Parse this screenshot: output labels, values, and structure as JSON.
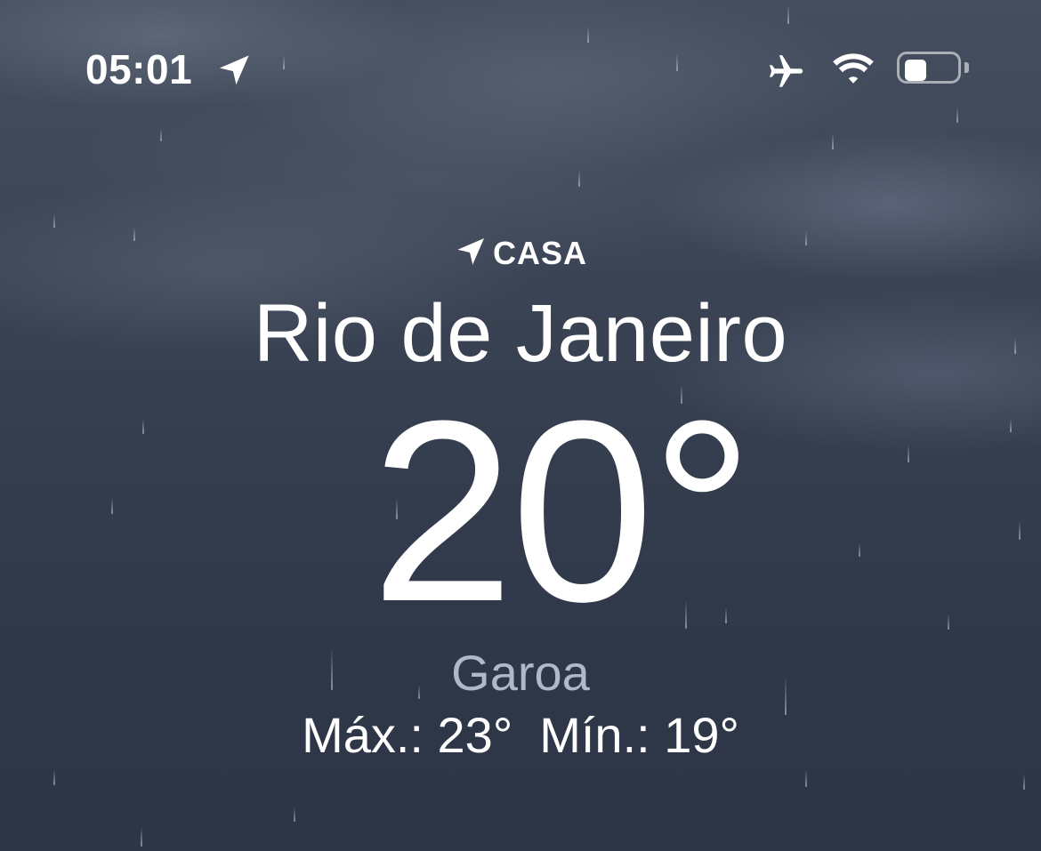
{
  "status_bar": {
    "time": "05:01",
    "location_icon": "location-arrow-icon",
    "airplane_icon": "airplane-icon",
    "wifi_icon": "wifi-icon",
    "battery_icon": "battery-icon",
    "battery_level": 0.45
  },
  "weather": {
    "home_label": "CASA",
    "home_icon": "navigation-arrow-icon",
    "city": "Rio de Janeiro",
    "temperature": "20°",
    "condition": "Garoa",
    "high": "Máx.: 23°",
    "low": "Mín.: 19°"
  },
  "colors": {
    "background_top": "#454e5e",
    "background_bottom": "#2d3647",
    "condition_text": "#aeb9cc",
    "primary_text": "#ffffff"
  }
}
